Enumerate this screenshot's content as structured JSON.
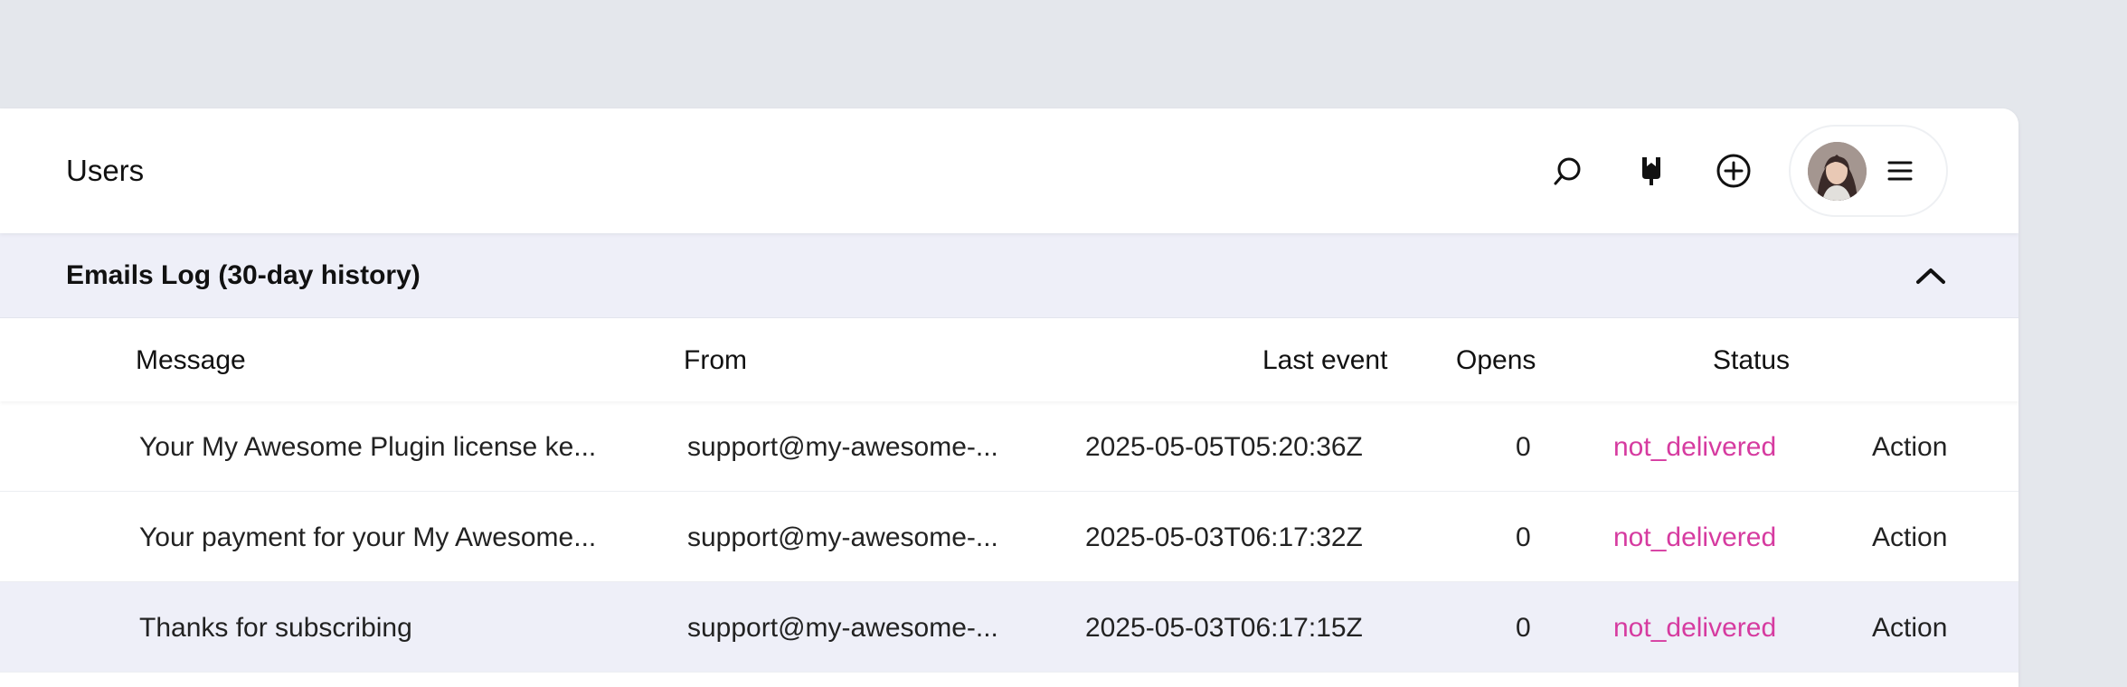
{
  "header": {
    "title": "Users",
    "icons": [
      "search-icon",
      "bookmark-icon",
      "add-circle-icon",
      "avatar",
      "menu-icon"
    ]
  },
  "section": {
    "title": "Emails Log (30-day history)",
    "toggle_icon": "chevron-up-icon"
  },
  "table": {
    "columns": {
      "message": "Message",
      "from": "From",
      "last_event": "Last event",
      "opens": "Opens",
      "status": "Status"
    },
    "rows": [
      {
        "message": "Your My Awesome Plugin license ke...",
        "from": "support@my-awesome-...",
        "last_event": "2025-05-05T05:20:36Z",
        "opens": "0",
        "status": "not_delivered",
        "action": "Action"
      },
      {
        "message": "Your payment for your My Awesome...",
        "from": "support@my-awesome-...",
        "last_event": "2025-05-03T06:17:32Z",
        "opens": "0",
        "status": "not_delivered",
        "action": "Action"
      },
      {
        "message": "Thanks for subscribing",
        "from": "support@my-awesome-...",
        "last_event": "2025-05-03T06:17:15Z",
        "opens": "0",
        "status": "not_delivered",
        "action": "Action"
      }
    ]
  },
  "colors": {
    "background": "#e4e7ec",
    "section_bg": "#eeeff8",
    "status_color": "#d63ba0"
  }
}
